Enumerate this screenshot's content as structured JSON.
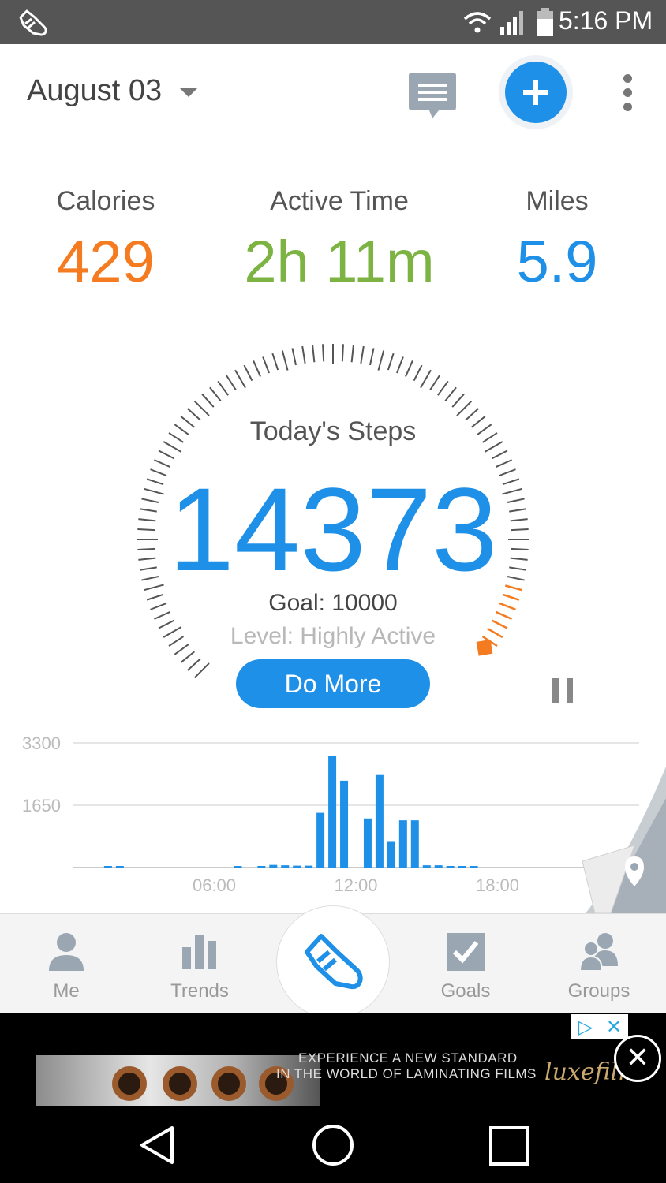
{
  "status_bar": {
    "time": "5:16 PM"
  },
  "header": {
    "date": "August 03"
  },
  "stats": {
    "calories": {
      "label": "Calories",
      "value": "429",
      "color": "#f47b20"
    },
    "active_time": {
      "label": "Active Time",
      "value": "2h 11m",
      "color": "#7cb342"
    },
    "miles": {
      "label": "Miles",
      "value": "5.9",
      "color": "#1e90e8"
    }
  },
  "gauge": {
    "title": "Today's Steps",
    "steps": "14373",
    "goal": "Goal: 10000",
    "level": "Level: Highly Active",
    "button": "Do More",
    "goal_progress": 1.0,
    "tick_color": "#555555",
    "overshoot_color": "#f47b20"
  },
  "chart_data": {
    "type": "bar",
    "title": "",
    "xlabel": "",
    "ylabel": "",
    "x_ticks": [
      "06:00",
      "12:00",
      "18:00"
    ],
    "y_ticks": [
      "3300",
      "1650"
    ],
    "ylim": [
      0,
      3300
    ],
    "xlim": [
      0,
      24
    ],
    "x_unit": "hour",
    "bar_color": "#1e90e8",
    "x": [
      1.5,
      2.0,
      7.0,
      8.0,
      8.5,
      9.0,
      9.5,
      10.0,
      10.5,
      11.0,
      11.5,
      12.0,
      12.5,
      13.0,
      13.5,
      14.0,
      14.5,
      15.0,
      15.5,
      16.0,
      16.5,
      17.0
    ],
    "values": [
      30,
      30,
      40,
      30,
      70,
      60,
      50,
      50,
      1450,
      2950,
      2300,
      0,
      1300,
      2450,
      700,
      1250,
      1250,
      60,
      60,
      40,
      40,
      40
    ]
  },
  "bottom_nav": {
    "me": "Me",
    "trends": "Trends",
    "goals": "Goals",
    "groups": "Groups"
  },
  "ad": {
    "line1": "EXPERIENCE A NEW STANDARD",
    "line2": "IN THE WORLD OF LAMINATING FILMS",
    "brand": "luxefilms"
  }
}
